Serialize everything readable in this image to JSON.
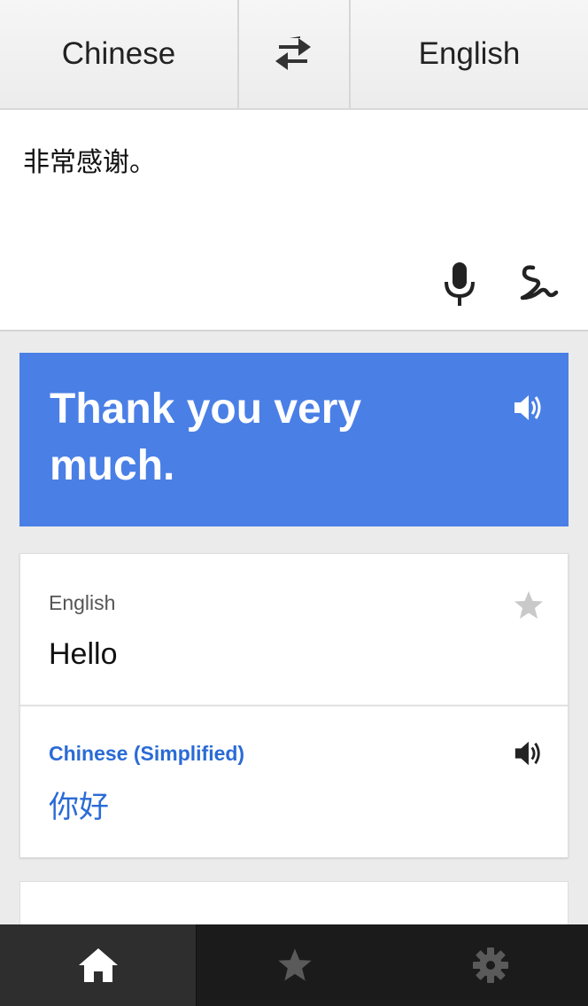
{
  "header": {
    "source_language": "Chinese",
    "target_language": "English",
    "swap_icon": "swap-arrows-icon"
  },
  "input": {
    "text": "非常感谢。",
    "mic_icon": "microphone-icon",
    "handwriting_icon": "handwriting-icon"
  },
  "translation": {
    "text": "Thank you very much.",
    "speaker_icon": "speaker-icon",
    "background_color": "#4a7fe6"
  },
  "phrasebook_card": {
    "source_language_label": "English",
    "source_phrase": "Hello",
    "star_icon": "star-icon",
    "target_language_label": "Chinese (Simplified)",
    "target_phrase": "你好",
    "speaker_icon": "speaker-icon",
    "accent_color": "#2a6bd6"
  },
  "tab_bar": {
    "tabs": [
      {
        "icon": "home-icon",
        "active": true
      },
      {
        "icon": "star-icon",
        "active": false
      },
      {
        "icon": "gear-icon",
        "active": false
      }
    ]
  }
}
